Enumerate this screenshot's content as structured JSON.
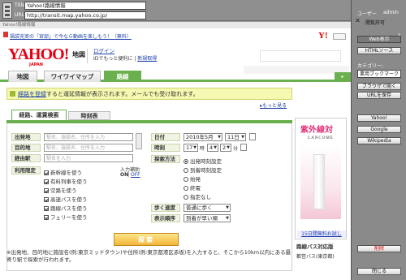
{
  "browser": {
    "title_label": "Title:",
    "title_value": "Yahoo!路線情報",
    "url_label": "URL:",
    "url_value": "http://transit.map.yahoo.co.jp/"
  },
  "page": {
    "breadcrumb": "Yahoo!路線情報",
    "promo": "福袋充実の「官邸」で今なら動画を楽しもう！（無料）",
    "logo": "YAHOO!",
    "logo_sub": "JAPAN",
    "header_map": "地図",
    "login_link": "ログイン",
    "id_text": "IDでもっと便利に",
    "signup_link": "新規取得",
    "tabs": [
      "地図",
      "ワイワイマップ",
      "路線"
    ],
    "notice_link": "経路を登録",
    "notice_text": "すると運延情報が表示されます。メールでも受け取れます。",
    "more_link": "もっと見る",
    "form_tabs": [
      "経路、運賃検索",
      "時刻表"
    ],
    "labels": {
      "from": "出発地",
      "to": "目的地",
      "via": "経由駅",
      "conditions": "利用限定",
      "date": "日付",
      "time": "時刻",
      "search_method": "探索方法",
      "walk_speed": "歩く速度",
      "order": "表示順序"
    },
    "placeholders": {
      "from": "駅名、施設名、住所を入力",
      "to": "駅名、施設名、住所を入力",
      "via": "駅名を入力"
    },
    "date_month": "2010年5月",
    "date_day": "11日",
    "time_hour": "17",
    "time_hour_unit": "時",
    "time_min_tens": "4",
    "time_min_ones": "2",
    "time_min_unit": "分",
    "input_assist": "入力補助",
    "assist_on": "ON",
    "assist_off": "OFF",
    "conditions": [
      "新幹線を使う",
      "有料列車を使う",
      "空路を使う",
      "高速バスを使う",
      "路線バスを使う",
      "フェリーを使う"
    ],
    "methods": [
      "出発時刻設定",
      "到着時刻設定",
      "始発",
      "終電",
      "指定なし"
    ],
    "walk_speed": "普通に歩く",
    "order": "到着が早い順",
    "search_button": "探索",
    "footnote": "※出発地、目的地に施設名(例:東京ミッドタウン)や住所(例:東京都港区赤坂)を入力すると、そこから10km以内にある最寄り駅で探索が行われます。"
  },
  "ad": {
    "title": "紫外線対",
    "brand": "LANCOME",
    "link": "15日間無料お試し",
    "line2": "路線バス対応版",
    "line3": "都営バス(東京都)"
  },
  "sidebar": {
    "user_label": "ユーザー",
    "user_name": "admin",
    "permission_label": "閲覧許可",
    "buttons": [
      "Web表示",
      "HTMLソース"
    ],
    "category_label": "カテゴリー:",
    "category_value": "業用ブックマーク",
    "action_buttons": [
      "ブラウザで開く",
      "URLを保存"
    ],
    "links": [
      "Yahoo!",
      "Google",
      "Wikipedia"
    ],
    "delete": "削除",
    "close": "閉じる"
  }
}
